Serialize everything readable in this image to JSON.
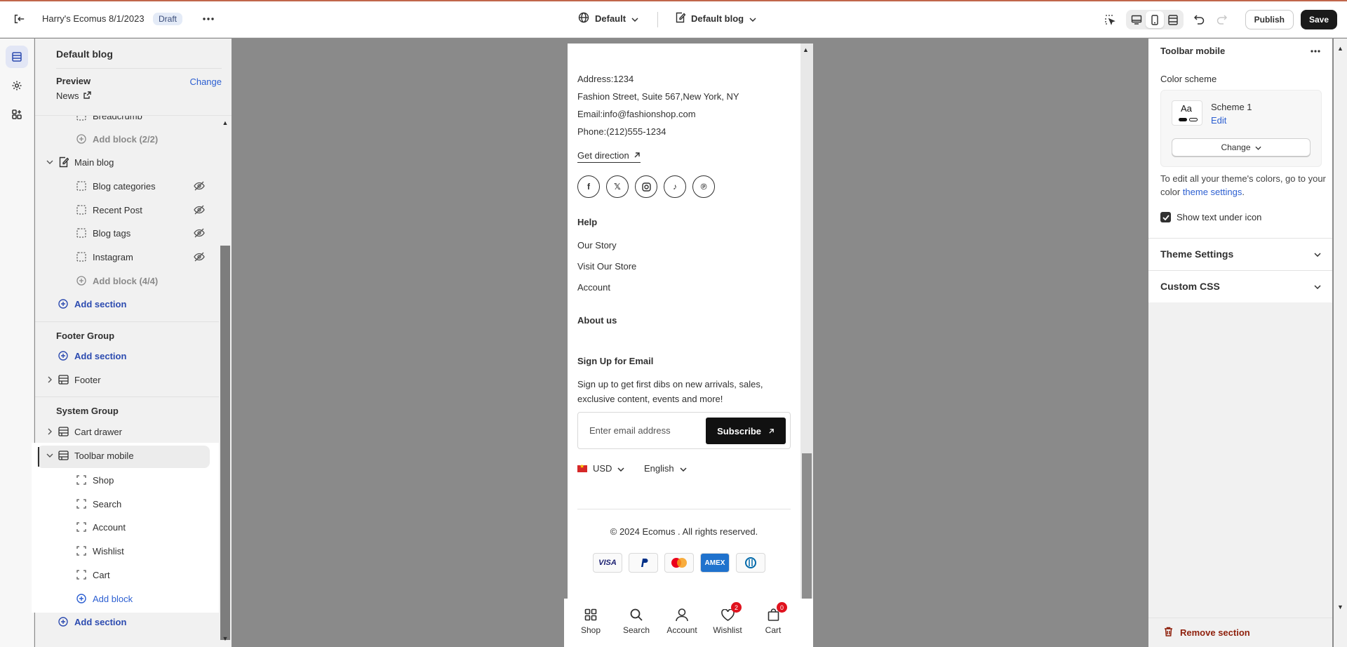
{
  "topbar": {
    "store_title": "Harry's Ecomus 8/1/2023",
    "status_badge": "Draft",
    "theme_selector": "Default",
    "template_selector": "Default blog",
    "publish_label": "Publish",
    "save_label": "Save"
  },
  "panel": {
    "title": "Default blog",
    "preview_label": "Preview",
    "change_label": "Change",
    "preview_page": "News"
  },
  "tree": {
    "breadcrumb": "Breadcrumb",
    "add_block_header": "Add block (2/2)",
    "main_blog": "Main blog",
    "main_blog_blocks": [
      "Blog categories",
      "Recent Post",
      "Blog tags",
      "Instagram"
    ],
    "add_block_main": "Add block (4/4)",
    "add_section": "Add section",
    "footer_group": "Footer Group",
    "footer": "Footer",
    "system_group": "System Group",
    "cart_drawer": "Cart drawer",
    "toolbar_mobile": "Toolbar mobile",
    "toolbar_blocks": [
      "Shop",
      "Search",
      "Account",
      "Wishlist",
      "Cart"
    ],
    "add_block": "Add block"
  },
  "preview": {
    "address": "Address:1234",
    "street": "Fashion Street, Suite 567,New York, NY",
    "email": "Email:info@fashionshop.com",
    "phone": "Phone:(212)555-1234",
    "get_direction": "Get direction",
    "socials": [
      "facebook-icon",
      "x-icon",
      "instagram-icon",
      "tiktok-icon",
      "pinterest-icon"
    ],
    "help_heading": "Help",
    "help_links": [
      "Our Story",
      "Visit Our Store",
      "Account"
    ],
    "about_heading": "About us",
    "signup_heading": "Sign Up for Email",
    "signup_line1": "Sign up to get first dibs on new arrivals, sales,",
    "signup_line2": "exclusive content, events and more!",
    "email_placeholder": "Enter email address",
    "subscribe_label": "Subscribe",
    "currency": "USD",
    "language": "English",
    "copyright": "© 2024 Ecomus . All rights reserved.",
    "payments": [
      "VISA",
      "PayPal",
      "Mastercard",
      "AMEX",
      "Diners"
    ],
    "toolbar": [
      {
        "label": "Shop",
        "icon": "grid-icon",
        "count": ""
      },
      {
        "label": "Search",
        "icon": "search-icon",
        "count": ""
      },
      {
        "label": "Account",
        "icon": "user-icon",
        "count": ""
      },
      {
        "label": "Wishlist",
        "icon": "heart-icon",
        "count": "2"
      },
      {
        "label": "Cart",
        "icon": "bag-icon",
        "count": "0"
      }
    ]
  },
  "settings": {
    "title": "Toolbar mobile",
    "color_scheme_label": "Color scheme",
    "scheme_sample": "Aa",
    "scheme_name": "Scheme 1",
    "scheme_edit": "Edit",
    "scheme_change": "Change",
    "help_text": "To edit all your theme's colors, go to your color",
    "help_link": "theme settings",
    "help_end": ".",
    "checkbox_label": "Show text under icon",
    "checkbox_checked": true,
    "accordion_theme": "Theme Settings",
    "accordion_css": "Custom CSS",
    "remove_section": "Remove section"
  },
  "colors": {
    "accent_blue": "#2c4bb0",
    "link_blue": "#2c5fd1",
    "danger": "#8e1f0b",
    "badge_red": "#e0121e"
  }
}
